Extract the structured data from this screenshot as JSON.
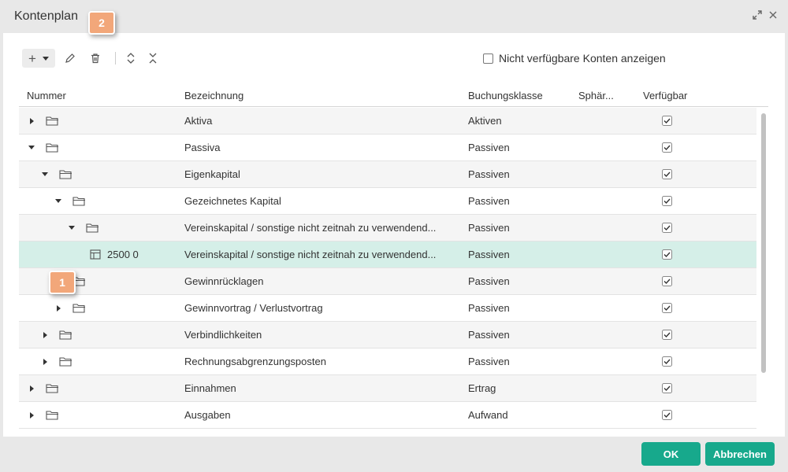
{
  "dialog": {
    "title": "Kontenplan",
    "header_icons": [
      "expand-icon",
      "close-icon"
    ]
  },
  "toolbar": {
    "add_icon": "+",
    "tools": [
      "edit-icon",
      "delete-icon",
      "expand-all-icon",
      "collapse-all-icon"
    ],
    "show_unavailable_label": "Nicht verfügbare Konten anzeigen",
    "show_unavailable_checked": false
  },
  "table": {
    "columns": [
      "Nummer",
      "Bezeichnung",
      "Buchungsklasse",
      "Sphär...",
      "Verfügbar"
    ],
    "rows": [
      {
        "level": 0,
        "expander": "closed",
        "icon": "folder-icon",
        "nummer": "",
        "bezeichnung": "Aktiva",
        "buchungsklasse": "Aktiven",
        "sphaere": "",
        "verfuegbar": true,
        "selected": false
      },
      {
        "level": 0,
        "expander": "open",
        "icon": "folder-icon",
        "nummer": "",
        "bezeichnung": "Passiva",
        "buchungsklasse": "Passiven",
        "sphaere": "",
        "verfuegbar": true,
        "selected": false
      },
      {
        "level": 1,
        "expander": "open",
        "icon": "folder-icon",
        "nummer": "",
        "bezeichnung": "Eigenkapital",
        "buchungsklasse": "Passiven",
        "sphaere": "",
        "verfuegbar": true,
        "selected": false
      },
      {
        "level": 2,
        "expander": "open",
        "icon": "folder-icon",
        "nummer": "",
        "bezeichnung": "Gezeichnetes Kapital",
        "buchungsklasse": "Passiven",
        "sphaere": "",
        "verfuegbar": true,
        "selected": false
      },
      {
        "level": 3,
        "expander": "open",
        "icon": "folder-icon",
        "nummer": "",
        "bezeichnung": "Vereinskapital / sonstige nicht zeitnah zu verwendend...",
        "buchungsklasse": "Passiven",
        "sphaere": "",
        "verfuegbar": true,
        "selected": false
      },
      {
        "level": 4,
        "expander": "none",
        "icon": "account-table-icon",
        "nummer": "2500 0",
        "bezeichnung": "Vereinskapital / sonstige nicht zeitnah zu verwendend...",
        "buchungsklasse": "Passiven",
        "sphaere": "",
        "verfuegbar": true,
        "selected": true
      },
      {
        "level": 2,
        "expander": "closed",
        "icon": "folder-icon",
        "nummer": "",
        "bezeichnung": "Gewinnrücklagen",
        "buchungsklasse": "Passiven",
        "sphaere": "",
        "verfuegbar": true,
        "selected": false
      },
      {
        "level": 2,
        "expander": "closed",
        "icon": "folder-icon",
        "nummer": "",
        "bezeichnung": "Gewinnvortrag / Verlustvortrag",
        "buchungsklasse": "Passiven",
        "sphaere": "",
        "verfuegbar": true,
        "selected": false
      },
      {
        "level": 1,
        "expander": "closed",
        "icon": "folder-icon",
        "nummer": "",
        "bezeichnung": "Verbindlichkeiten",
        "buchungsklasse": "Passiven",
        "sphaere": "",
        "verfuegbar": true,
        "selected": false
      },
      {
        "level": 1,
        "expander": "closed",
        "icon": "folder-icon",
        "nummer": "",
        "bezeichnung": "Rechnungsabgrenzungsposten",
        "buchungsklasse": "Passiven",
        "sphaere": "",
        "verfuegbar": true,
        "selected": false
      },
      {
        "level": 0,
        "expander": "closed",
        "icon": "folder-icon",
        "nummer": "",
        "bezeichnung": "Einnahmen",
        "buchungsklasse": "Ertrag",
        "sphaere": "",
        "verfuegbar": true,
        "selected": false
      },
      {
        "level": 0,
        "expander": "closed",
        "icon": "folder-icon",
        "nummer": "",
        "bezeichnung": "Ausgaben",
        "buchungsklasse": "Aufwand",
        "sphaere": "",
        "verfuegbar": true,
        "selected": false
      }
    ]
  },
  "footer": {
    "ok_label": "OK",
    "cancel_label": "Abbrechen"
  },
  "callouts": [
    "1",
    "2"
  ],
  "colors": {
    "accent": "#17a98c",
    "selected_row": "#d5efe8",
    "callout": "#f2a77a",
    "chrome": "#e8e8e8"
  }
}
